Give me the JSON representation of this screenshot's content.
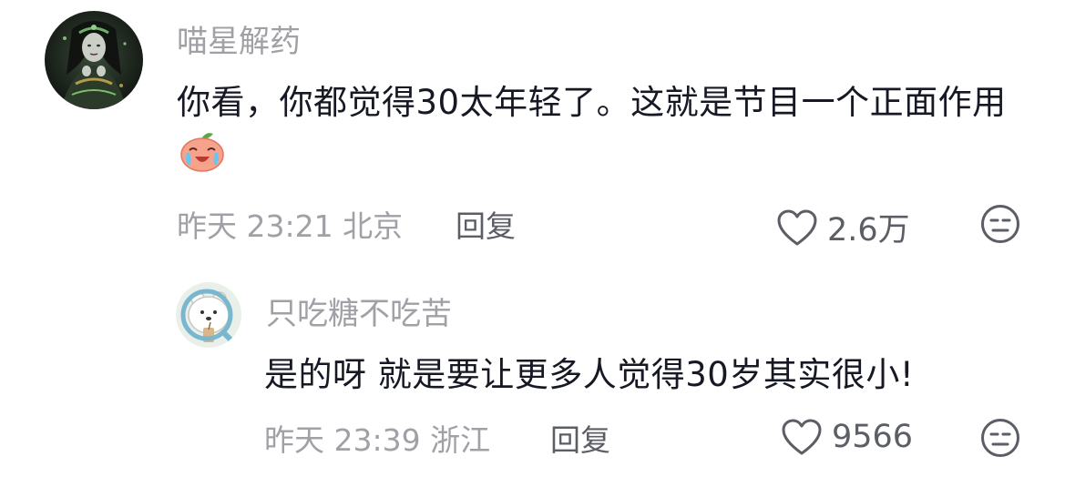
{
  "comments": [
    {
      "username": "喵星解药",
      "text": "你看，你都觉得30太年轻了。这就是节目一个正面作用",
      "emoji": "crying-laughing-peach-emoji",
      "time": "昨天 23:21",
      "location": "北京",
      "reply_label": "回复",
      "likes": "2.6万",
      "avatar": "avatar-dark-costume-woman"
    },
    {
      "username": "只吃糖不吃苦",
      "text": "是的呀 就是要让更多人觉得30岁其实很小!",
      "time": "昨天 23:39",
      "location": "浙江",
      "reply_label": "回复",
      "likes": "9566",
      "avatar": "avatar-cartoon-bear-magnifier"
    }
  ],
  "icons": {
    "like": "heart-outline-icon",
    "dislike": "unamused-face-icon"
  },
  "colors": {
    "text_primary": "#161823",
    "text_secondary": "#a0a1a6",
    "text_action": "#5c5e66"
  }
}
